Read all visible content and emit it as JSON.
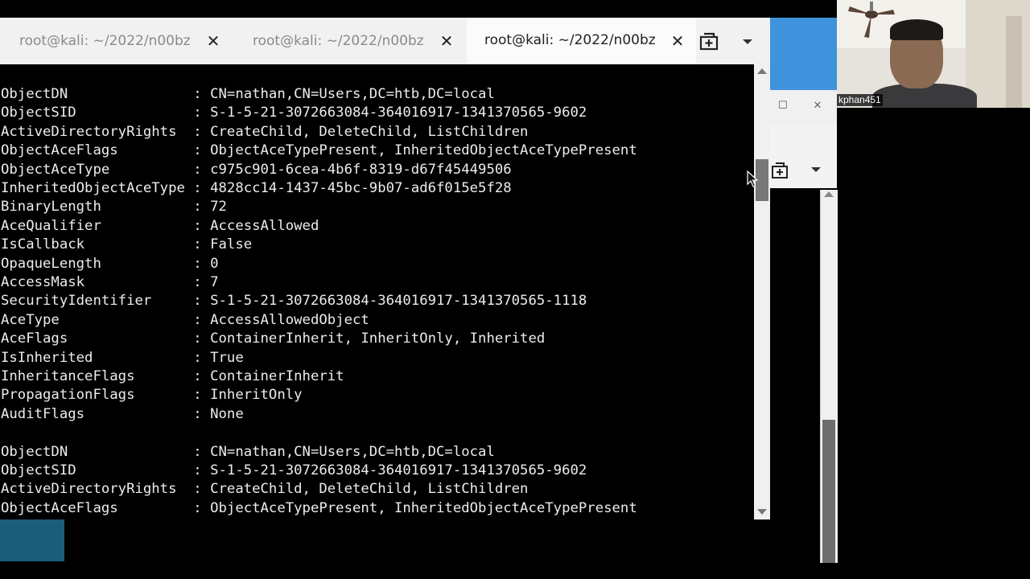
{
  "tabs": [
    {
      "label": "root@kali: ~/2022/n00bz",
      "active": false
    },
    {
      "label": "root@kali: ~/2022/n00bz",
      "active": false
    },
    {
      "label": "root@kali: ~/2022/n00bz",
      "active": true
    }
  ],
  "tab_close_symbol": "✕",
  "icons": {
    "new_tab": "new-tab-icon",
    "tab_menu": "chevron-down-icon",
    "close": "close-icon",
    "maximize": "maximize-icon",
    "cursor": "mouse-pointer-icon"
  },
  "terminal": {
    "lines": [
      "ObjectDN               : CN=nathan,CN=Users,DC=htb,DC=local",
      "ObjectSID              : S-1-5-21-3072663084-364016917-1341370565-9602",
      "ActiveDirectoryRights  : CreateChild, DeleteChild, ListChildren",
      "ObjectAceFlags         : ObjectAceTypePresent, InheritedObjectAceTypePresent",
      "ObjectAceType          : c975c901-6cea-4b6f-8319-d67f45449506",
      "InheritedObjectAceType : 4828cc14-1437-45bc-9b07-ad6f015e5f28",
      "BinaryLength           : 72",
      "AceQualifier           : AccessAllowed",
      "IsCallback             : False",
      "OpaqueLength           : 0",
      "AccessMask             : 7",
      "SecurityIdentifier     : S-1-5-21-3072663084-364016917-1341370565-1118",
      "AceType                : AccessAllowedObject",
      "AceFlags               : ContainerInherit, InheritOnly, Inherited",
      "IsInherited            : True",
      "InheritanceFlags       : ContainerInherit",
      "PropagationFlags       : InheritOnly",
      "AuditFlags             : None",
      "",
      "ObjectDN               : CN=nathan,CN=Users,DC=htb,DC=local",
      "ObjectSID              : S-1-5-21-3072663084-364016917-1341370565-9602",
      "ActiveDirectoryRights  : CreateChild, DeleteChild, ListChildren",
      "ObjectAceFlags         : ObjectAceTypePresent, InheritedObjectAceTypePresent"
    ]
  },
  "webcam": {
    "name": "kphan451"
  },
  "colors": {
    "terminal_bg": "#000000",
    "terminal_fg": "#ececec",
    "tabbar_bg": "#f1f1f1",
    "desktop_blue": "#3f93dd"
  }
}
